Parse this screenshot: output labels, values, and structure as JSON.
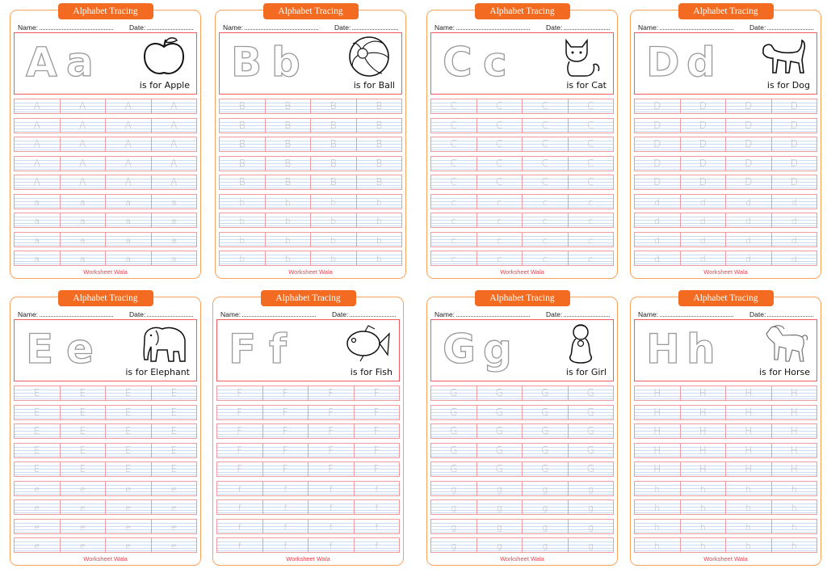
{
  "footer_brand": "Worksheet Wala",
  "tab_title": "Alphabet Tracing",
  "name_label": "Name:",
  "date_label": "Date:",
  "colors": {
    "accent_orange": "#f26b21",
    "border_orange": "#f7a35c",
    "hero_border_red": "#ef5b60",
    "row_border_pink": "#ef9a9e",
    "guide_line_blue": "#c9dcf2",
    "footer_red": "#ef3f4a",
    "trace_letter_gray": "#b9b9b9"
  },
  "worksheets": [
    {
      "upper": "A",
      "lower": "a",
      "caption": "is for Apple",
      "picture": "apple-icon",
      "uppercase_rows": 5,
      "lowercase_rows": 4,
      "cells_per_row": 4
    },
    {
      "upper": "B",
      "lower": "b",
      "caption": "is for Ball",
      "picture": "ball-icon",
      "uppercase_rows": 5,
      "lowercase_rows": 4,
      "cells_per_row": 4
    },
    {
      "upper": "C",
      "lower": "c",
      "caption": "is for Cat",
      "picture": "cat-icon",
      "uppercase_rows": 5,
      "lowercase_rows": 4,
      "cells_per_row": 4
    },
    {
      "upper": "D",
      "lower": "d",
      "caption": "is for Dog",
      "picture": "dog-icon",
      "uppercase_rows": 5,
      "lowercase_rows": 4,
      "cells_per_row": 4
    },
    {
      "upper": "E",
      "lower": "e",
      "caption": "is for Elephant",
      "picture": "elephant-icon",
      "uppercase_rows": 5,
      "lowercase_rows": 4,
      "cells_per_row": 4
    },
    {
      "upper": "F",
      "lower": "f",
      "caption": "is for Fish",
      "picture": "fish-icon",
      "uppercase_rows": 5,
      "lowercase_rows": 4,
      "cells_per_row": 4
    },
    {
      "upper": "G",
      "lower": "g",
      "caption": "is for Girl",
      "picture": "girl-icon",
      "uppercase_rows": 5,
      "lowercase_rows": 4,
      "cells_per_row": 4
    },
    {
      "upper": "H",
      "lower": "h",
      "caption": "is for Horse",
      "picture": "horse-icon",
      "uppercase_rows": 5,
      "lowercase_rows": 4,
      "cells_per_row": 4
    }
  ]
}
